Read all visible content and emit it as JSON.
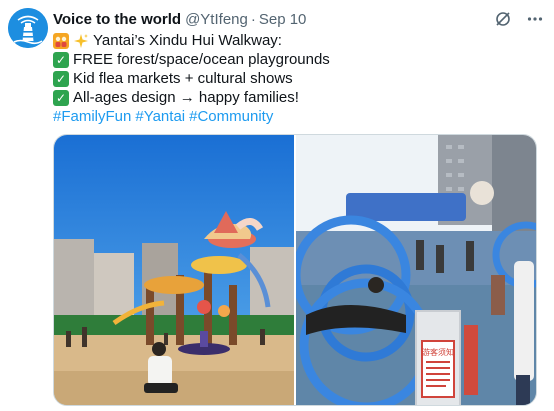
{
  "tweet": {
    "author_name": "Voice to the world",
    "handle": "@YtIfeng",
    "separator": "·",
    "date": "Sep 10",
    "lines": [
      "Yantai’s Xindu Hui Walkway:",
      "FREE forest/space/ocean playgrounds",
      "Kid flea markets + cultural shows",
      "All-ages design → happy families!"
    ],
    "hashtags": [
      "#FamilyFun",
      "#Yantai",
      "#Community"
    ]
  },
  "icons": {
    "avatar": "lighthouse-icon",
    "grok": "grok-icon",
    "more": "more-icon",
    "title_emoji": "family-sparkles-emoji",
    "check": "check-mark-emoji"
  },
  "colors": {
    "link": "#1d9bf0",
    "avatar": "#1d8ee0",
    "check": "#2ea44f",
    "muted": "#536471"
  },
  "media": {
    "count": 2,
    "sign_text": "游客须知"
  }
}
